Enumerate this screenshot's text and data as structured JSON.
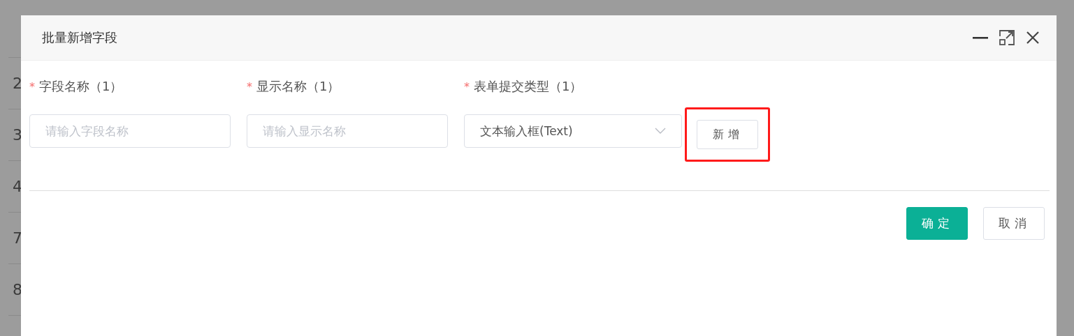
{
  "background_table": {
    "row_numbers": [
      "2",
      "3",
      "4",
      "7",
      "8"
    ]
  },
  "dialog": {
    "title": "批量新增字段",
    "fields": [
      {
        "kind": "input",
        "required_mark": "*",
        "label": "字段名称（1）",
        "placeholder": "请输入字段名称"
      },
      {
        "kind": "input",
        "required_mark": "*",
        "label": "显示名称（1）",
        "placeholder": "请输入显示名称"
      },
      {
        "kind": "select",
        "required_mark": "*",
        "label": "表单提交类型（1）",
        "value": "文本输入框(Text)"
      }
    ],
    "add_button": {
      "label": "新增",
      "highlighted": true
    },
    "footer_buttons": [
      {
        "kind": "primary",
        "label": "确定"
      },
      {
        "kind": "default",
        "label": "取消"
      }
    ]
  }
}
